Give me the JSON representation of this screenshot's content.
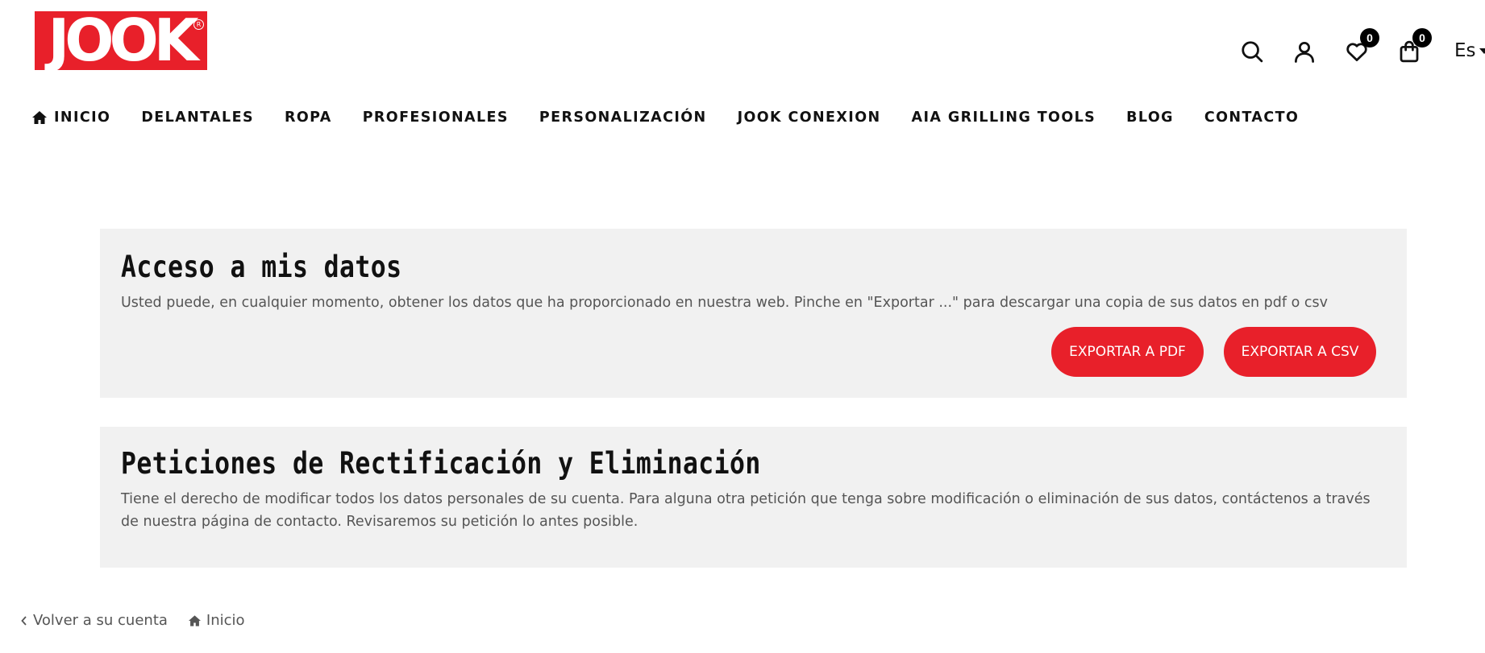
{
  "logo": {
    "text": "JOOK",
    "reg": "R",
    "color": "#e8202a"
  },
  "header": {
    "wishlist_count": "0",
    "cart_count": "0",
    "language": "Es"
  },
  "nav": {
    "items": [
      {
        "label": "INICIO"
      },
      {
        "label": "DELANTALES"
      },
      {
        "label": "ROPA"
      },
      {
        "label": "PROFESIONALES"
      },
      {
        "label": "PERSONALIZACIÓN"
      },
      {
        "label": "JOOK CONEXION"
      },
      {
        "label": "AIA GRILLING TOOLS"
      },
      {
        "label": "BLOG"
      },
      {
        "label": "CONTACTO"
      }
    ]
  },
  "access": {
    "title": "Acceso a mis datos",
    "text": "Usted puede, en cualquier momento, obtener los datos que ha proporcionado en nuestra web. Pinche en \"Exportar ...\" para descargar una copia de sus datos en pdf o csv",
    "export_pdf": "EXPORTAR A PDF",
    "export_csv": "EXPORTAR A CSV"
  },
  "requests": {
    "title": "Peticiones de Rectificación y Eliminación",
    "text_before": "Tiene el derecho de modificar todos los datos personales de su cuenta. Para alguna otra petición que tenga sobre modificación o eliminación de sus datos, contáctenos a través de nuestra ",
    "link": "página de contacto",
    "text_after": ". Revisaremos su petición lo antes posible."
  },
  "footer": {
    "back": "Volver a su cuenta",
    "home": "Inicio"
  },
  "colors": {
    "accent": "#e8202a",
    "panel_bg": "#f1f1f1"
  }
}
